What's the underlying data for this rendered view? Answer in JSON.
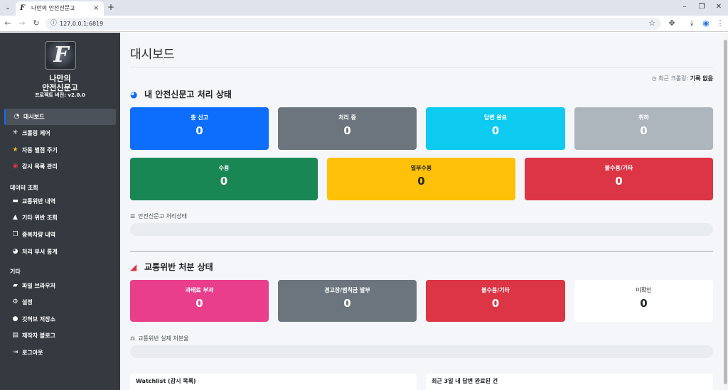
{
  "browser": {
    "tab_title": "나만의 안전신문고",
    "favicon_letter": "F",
    "url": "127.0.0.1:6819",
    "tab_close": "×",
    "new_tab": "+"
  },
  "sidebar": {
    "logo_letter": "F",
    "brand_line1": "나만의",
    "brand_line2": "안전신문고",
    "version": "프로젝트 버전: v2.0.0",
    "items": [
      {
        "label": "대시보드",
        "icon": "dashboard-icon",
        "glyph": "◔"
      },
      {
        "label": "크롤링 제어",
        "icon": "spider-icon",
        "glyph": "✳"
      },
      {
        "label": "자동 별점 주기",
        "icon": "star-icon",
        "glyph": "★"
      },
      {
        "label": "감시 목록 관리",
        "icon": "eye-icon",
        "glyph": "◉"
      }
    ],
    "section_data": "데이터 조회",
    "data_items": [
      {
        "label": "교통위반 내역",
        "icon": "car-icon",
        "glyph": "▬"
      },
      {
        "label": "기타 위반 조회",
        "icon": "warning-icon",
        "glyph": "▲"
      },
      {
        "label": "중복차량 내역",
        "icon": "copy-icon",
        "glyph": "❐"
      },
      {
        "label": "처리 부서 통계",
        "icon": "pie-chart-icon",
        "glyph": "◕"
      }
    ],
    "section_etc": "기타",
    "etc_items": [
      {
        "label": "파일 브라우저",
        "icon": "folder-icon",
        "glyph": "▰"
      },
      {
        "label": "설정",
        "icon": "gear-icon",
        "glyph": "⚙"
      },
      {
        "label": "깃허브 저장소",
        "icon": "github-icon",
        "glyph": "●"
      },
      {
        "label": "제작자 블로그",
        "icon": "book-icon",
        "glyph": "▤"
      },
      {
        "label": "로그아웃",
        "icon": "logout-icon",
        "glyph": "⇥"
      }
    ]
  },
  "main": {
    "title": "대시보드",
    "crawl_label": "최근 크롤링:",
    "crawl_value": "기록 없음",
    "section1_title": "내 안전신문고 처리 상태",
    "row1": [
      {
        "label": "총 신고",
        "value": "0",
        "color": "#0d6efd"
      },
      {
        "label": "처리 중",
        "value": "0",
        "color": "#6c757d"
      },
      {
        "label": "답변 완료",
        "value": "0",
        "color": "#0dcaf0"
      },
      {
        "label": "취하",
        "value": "0",
        "color": "#adb5bd"
      }
    ],
    "row2": [
      {
        "label": "수용",
        "value": "0",
        "color": "#198754"
      },
      {
        "label": "일부수용",
        "value": "0",
        "color": "#ffc107"
      },
      {
        "label": "불수용/기타",
        "value": "0",
        "color": "#dc3545"
      }
    ],
    "progress1_label": "안전신문고 처리상태",
    "progress1_value": 0,
    "section2_title": "교통위반 처분 상태",
    "row3": [
      {
        "label": "과태료 부과",
        "value": "0",
        "color": "#e83e8c"
      },
      {
        "label": "경고장/범칙금 발부",
        "value": "0",
        "color": "#6c757d"
      },
      {
        "label": "불수용/기타",
        "value": "0",
        "color": "#dc3545"
      },
      {
        "label": "미확인",
        "value": "0",
        "color": "#ffffff"
      }
    ],
    "progress2_label": "교통위반 실제 처분율",
    "progress2_value": 0,
    "panel_left_title": "Watchlist (감시 목록)",
    "panel_right_title": "최근 3일 내 답변 완료된 건"
  }
}
